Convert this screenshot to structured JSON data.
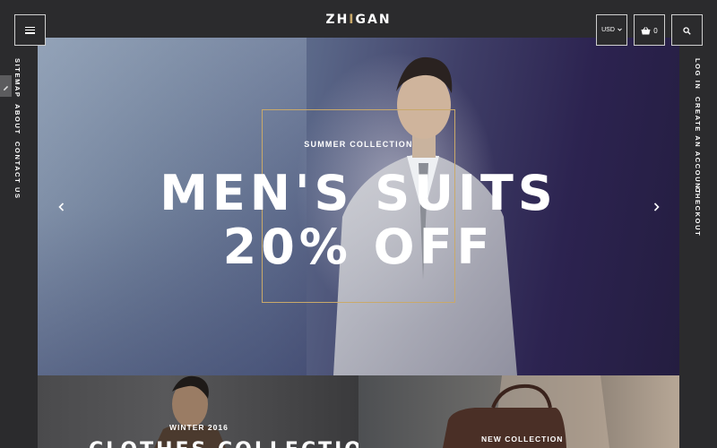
{
  "header": {
    "logo_main_1": "ZH",
    "logo_accent": "I",
    "logo_main_2": "GAN",
    "currency": "USD",
    "cart_count": "0"
  },
  "left_nav": [
    "SITEMAP",
    "ABOUT",
    "CONTACT US"
  ],
  "right_nav": [
    "LOG IN",
    "CREATE AN ACCOUNT",
    "CHECKOUT"
  ],
  "hero": {
    "subtitle": "SUMMER COLLECTION",
    "line1": "MEN'S SUITS",
    "line2": "20% OFF"
  },
  "tiles": [
    {
      "subtitle": "WINTER 2016",
      "title": "CLOTHES COLLECTION"
    },
    {
      "subtitle": "NEW COLLECTION",
      "title": ""
    }
  ],
  "colors": {
    "background": "#2b2b2d",
    "accent_gold": "#c9a96a",
    "text": "#ffffff"
  },
  "icons": [
    "menu-icon",
    "chevron-down-icon",
    "basket-icon",
    "search-icon",
    "pencil-icon",
    "chevron-left-icon",
    "chevron-right-icon"
  ]
}
